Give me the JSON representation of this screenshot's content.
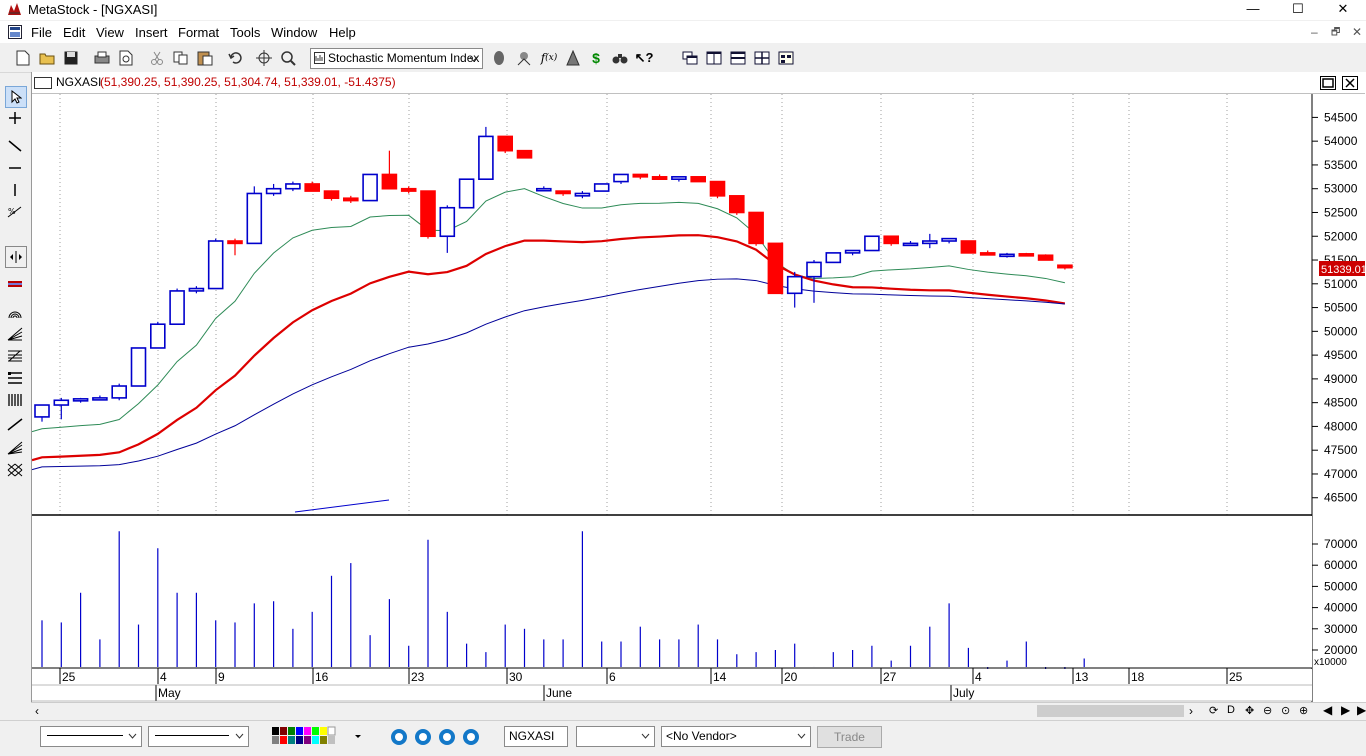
{
  "window": {
    "title": "MetaStock - [NGXASI]",
    "controls": [
      "—",
      "☐",
      "✕"
    ],
    "mdi_controls": [
      "–",
      "🗗",
      "✕"
    ]
  },
  "menu": [
    "File",
    "Edit",
    "View",
    "Insert",
    "Format",
    "Tools",
    "Window",
    "Help"
  ],
  "toolbar": {
    "indicator_selected": "Stochastic Momentum Index"
  },
  "chart": {
    "symbol": "NGXASI",
    "ohlc_readout": "(51,390.25, 51,390.25, 51,304.74, 51,339.01, -51.4375)",
    "last_price_tag": "51339.01",
    "volume_multiplier": "x10000",
    "price_axis": [
      "54500",
      "54000",
      "53500",
      "53000",
      "52500",
      "52000",
      "51500",
      "51000",
      "50500",
      "50000",
      "49500",
      "49000",
      "48500",
      "48000",
      "47500",
      "47000",
      "46500"
    ],
    "volume_axis": [
      "70000",
      "60000",
      "50000",
      "40000",
      "30000",
      "20000"
    ],
    "date_ticks": [
      "25",
      "4",
      "9",
      "16",
      "23",
      "30",
      "6",
      "14",
      "20",
      "27",
      "4",
      "13",
      "18",
      "25"
    ],
    "month_labels": [
      "May",
      "June",
      "July"
    ]
  },
  "chart_data": {
    "type": "candlestick",
    "price_ylim": [
      46200,
      54950
    ],
    "candles": [
      {
        "o": 48200,
        "h": 48450,
        "l": 48100,
        "c": 48450
      },
      {
        "o": 48450,
        "h": 48600,
        "l": 48150,
        "c": 48550
      },
      {
        "o": 48550,
        "h": 48600,
        "l": 48500,
        "c": 48580
      },
      {
        "o": 48580,
        "h": 48650,
        "l": 48550,
        "c": 48600
      },
      {
        "o": 48600,
        "h": 48900,
        "l": 48550,
        "c": 48850
      },
      {
        "o": 48850,
        "h": 49650,
        "l": 48850,
        "c": 49650
      },
      {
        "o": 49650,
        "h": 50200,
        "l": 49650,
        "c": 50150
      },
      {
        "o": 50150,
        "h": 50900,
        "l": 50150,
        "c": 50850
      },
      {
        "o": 50850,
        "h": 50950,
        "l": 50800,
        "c": 50900
      },
      {
        "o": 50900,
        "h": 51950,
        "l": 50900,
        "c": 51900
      },
      {
        "o": 51900,
        "h": 51950,
        "l": 51600,
        "c": 51850
      },
      {
        "o": 51850,
        "h": 53050,
        "l": 51850,
        "c": 52900
      },
      {
        "o": 52900,
        "h": 53100,
        "l": 52850,
        "c": 53000
      },
      {
        "o": 53000,
        "h": 53150,
        "l": 52950,
        "c": 53100
      },
      {
        "o": 53100,
        "h": 53150,
        "l": 52950,
        "c": 52950
      },
      {
        "o": 52950,
        "h": 52950,
        "l": 52750,
        "c": 52800
      },
      {
        "o": 52800,
        "h": 52850,
        "l": 52700,
        "c": 52750
      },
      {
        "o": 52750,
        "h": 53300,
        "l": 52750,
        "c": 53300
      },
      {
        "o": 53300,
        "h": 53800,
        "l": 53000,
        "c": 53000
      },
      {
        "o": 53000,
        "h": 53050,
        "l": 52900,
        "c": 52950
      },
      {
        "o": 52950,
        "h": 52950,
        "l": 51950,
        "c": 52000
      },
      {
        "o": 52000,
        "h": 52650,
        "l": 51650,
        "c": 52600
      },
      {
        "o": 52600,
        "h": 53200,
        "l": 52600,
        "c": 53200
      },
      {
        "o": 53200,
        "h": 54300,
        "l": 53200,
        "c": 54100
      },
      {
        "o": 54100,
        "h": 54100,
        "l": 53750,
        "c": 53800
      },
      {
        "o": 53800,
        "h": 53800,
        "l": 53650,
        "c": 53650
      },
      {
        "o": 53000,
        "h": 53050,
        "l": 52950,
        "c": 53000
      },
      {
        "o": 52950,
        "h": 52950,
        "l": 52850,
        "c": 52900
      },
      {
        "o": 52850,
        "h": 52950,
        "l": 52800,
        "c": 52900
      },
      {
        "o": 52950,
        "h": 53100,
        "l": 52950,
        "c": 53100
      },
      {
        "o": 53150,
        "h": 53300,
        "l": 53100,
        "c": 53300
      },
      {
        "o": 53300,
        "h": 53300,
        "l": 53200,
        "c": 53250
      },
      {
        "o": 53250,
        "h": 53300,
        "l": 53200,
        "c": 53200
      },
      {
        "o": 53200,
        "h": 53250,
        "l": 53150,
        "c": 53250
      },
      {
        "o": 53250,
        "h": 53250,
        "l": 53150,
        "c": 53150
      },
      {
        "o": 53150,
        "h": 53150,
        "l": 52800,
        "c": 52850
      },
      {
        "o": 52850,
        "h": 52850,
        "l": 52450,
        "c": 52500
      },
      {
        "o": 52500,
        "h": 52500,
        "l": 51800,
        "c": 51850
      },
      {
        "o": 51850,
        "h": 51850,
        "l": 50800,
        "c": 50800
      },
      {
        "o": 50800,
        "h": 51250,
        "l": 50500,
        "c": 51150
      },
      {
        "o": 51150,
        "h": 51500,
        "l": 50600,
        "c": 51450
      },
      {
        "o": 51450,
        "h": 51650,
        "l": 51450,
        "c": 51650
      },
      {
        "o": 51650,
        "h": 51700,
        "l": 51600,
        "c": 51700
      },
      {
        "o": 51700,
        "h": 52000,
        "l": 51700,
        "c": 52000
      },
      {
        "o": 52000,
        "h": 52000,
        "l": 51800,
        "c": 51850
      },
      {
        "o": 51850,
        "h": 51900,
        "l": 51800,
        "c": 51850
      },
      {
        "o": 51850,
        "h": 52050,
        "l": 51750,
        "c": 51900
      },
      {
        "o": 51900,
        "h": 51950,
        "l": 51850,
        "c": 51950
      },
      {
        "o": 51900,
        "h": 51900,
        "l": 51650,
        "c": 51650
      },
      {
        "o": 51650,
        "h": 51700,
        "l": 51600,
        "c": 51630
      },
      {
        "o": 51600,
        "h": 51650,
        "l": 51550,
        "c": 51620
      },
      {
        "o": 51630,
        "h": 51650,
        "l": 51580,
        "c": 51600
      },
      {
        "o": 51600,
        "h": 51620,
        "l": 51500,
        "c": 51500
      },
      {
        "o": 51390,
        "h": 51390,
        "l": 51300,
        "c": 51339
      }
    ],
    "volume": [
      34,
      33,
      47,
      25,
      76,
      32,
      68,
      47,
      47,
      34,
      33,
      42,
      43,
      30,
      38,
      55,
      61,
      27,
      44,
      22,
      72,
      38,
      23,
      19,
      32,
      30,
      25,
      25,
      76,
      24,
      24,
      31,
      25,
      25,
      32,
      25,
      18,
      19,
      20,
      23,
      12,
      19,
      20,
      22,
      15,
      22,
      31,
      42,
      21,
      8,
      15,
      24,
      5,
      5,
      16
    ]
  }
}
